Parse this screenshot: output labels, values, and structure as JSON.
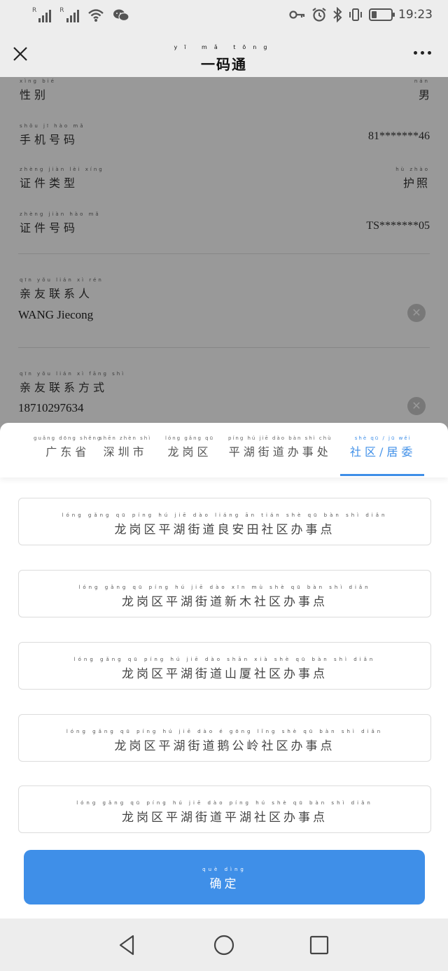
{
  "status_bar": {
    "time": "19:23",
    "sim1_label": "R",
    "sim2_label": "R",
    "icons": [
      "signal-icon",
      "signal-icon",
      "wifi-icon",
      "wechat-icon",
      "key-icon",
      "alarm-icon",
      "bluetooth-icon",
      "vibrate-icon",
      "battery-icon"
    ]
  },
  "nav": {
    "title": "一码通",
    "title_pinyin": "yī mǎ tōng"
  },
  "form": {
    "gender": {
      "pinyin": "xìng bié",
      "label": "性别",
      "value_pinyin": "nán",
      "value": "男"
    },
    "phone": {
      "pinyin": "shǒu jī hào mǎ",
      "label": "手机号码",
      "value": "81*******46"
    },
    "id_type": {
      "pinyin": "zhèng jiàn lèi xíng",
      "label": "证件类型",
      "value_pinyin": "hù zhào",
      "value": "护照"
    },
    "id_number": {
      "pinyin": "zhèng jiàn hào mǎ",
      "label": "证件号码",
      "value": "TS*******05"
    },
    "contact_name": {
      "pinyin": "qīn yǒu lián xì rén",
      "label": "亲友联系人",
      "value": "WANG Jiecong"
    },
    "contact_phone": {
      "pinyin": "qīn yǒu lián xì fāng shì",
      "label": "亲友联系方式",
      "value": "18710297634"
    },
    "clear_symbol": "✕"
  },
  "region_tabs": [
    {
      "pinyin": "guǎng dōng shěng",
      "label": "广东省"
    },
    {
      "pinyin": "shēn zhèn shì",
      "label": "深圳市"
    },
    {
      "pinyin": "lóng gǎng qū",
      "label": "龙岗区"
    },
    {
      "pinyin": "píng hú jiē dào bàn shì chù",
      "label": "平湖街道办事处"
    },
    {
      "pinyin": "shè qū / jū wěi",
      "label": "社区/居委"
    }
  ],
  "options": [
    {
      "pinyin": "lóng gǎng qū píng hú jiē dào liáng ān tián shè qū bàn shì diǎn",
      "label": "龙岗区平湖街道良安田社区办事点"
    },
    {
      "pinyin": "lóng gǎng qū píng hú jiē dào xīn mù shè qū bàn shì diǎn",
      "label": "龙岗区平湖街道新木社区办事点"
    },
    {
      "pinyin": "lóng gǎng qū píng hú jiē dào shān xià shè qū bàn shì diǎn",
      "label": "龙岗区平湖街道山厦社区办事点"
    },
    {
      "pinyin": "lóng gǎng qū píng hú jiē dào é gōng lǐng shè qū bàn shì diǎn",
      "label": "龙岗区平湖街道鹅公岭社区办事点"
    },
    {
      "pinyin": "lóng gǎng qū píng hú jiē dào píng hú shè qū bàn shì diǎn",
      "label": "龙岗区平湖街道平湖社区办事点"
    }
  ],
  "confirm": {
    "pinyin": "què dìng",
    "label": "确定"
  },
  "colors": {
    "accent": "#3f8fe8",
    "overlay": "rgba(0,0,0,0.40)",
    "bar_bg": "#ededed"
  }
}
